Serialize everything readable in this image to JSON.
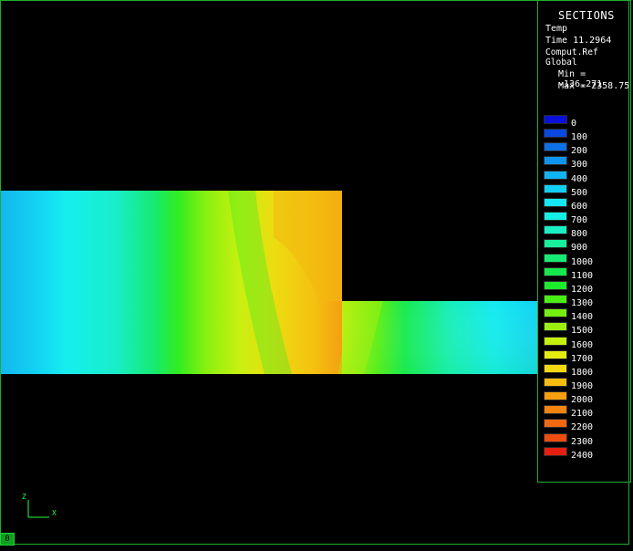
{
  "panel": {
    "title": "SECTIONS",
    "result": "Temp",
    "time": "Time 11.2964",
    "reference": "Comput.Ref Global",
    "min": "Min = -136.271",
    "max": "Max = 2358.75"
  },
  "legend": [
    {
      "label": "0",
      "color": "#0a10d8"
    },
    {
      "label": "100",
      "color": "#0b48e0"
    },
    {
      "label": "200",
      "color": "#0d72e8"
    },
    {
      "label": "300",
      "color": "#0e94ee"
    },
    {
      "label": "400",
      "color": "#10b4f2"
    },
    {
      "label": "500",
      "color": "#12cef4"
    },
    {
      "label": "600",
      "color": "#14e6f4"
    },
    {
      "label": "700",
      "color": "#16f0e4"
    },
    {
      "label": "800",
      "color": "#18f0c4"
    },
    {
      "label": "900",
      "color": "#18ee9c"
    },
    {
      "label": "1000",
      "color": "#16ec74"
    },
    {
      "label": "1100",
      "color": "#14e84c"
    },
    {
      "label": "1200",
      "color": "#1cec2c"
    },
    {
      "label": "1300",
      "color": "#48ee14"
    },
    {
      "label": "1400",
      "color": "#74f010"
    },
    {
      "label": "1500",
      "color": "#9cf010"
    },
    {
      "label": "1600",
      "color": "#c4f010"
    },
    {
      "label": "1700",
      "color": "#e4ec10"
    },
    {
      "label": "1800",
      "color": "#f4d810"
    },
    {
      "label": "1900",
      "color": "#f6bc10"
    },
    {
      "label": "2000",
      "color": "#f6a010"
    },
    {
      "label": "2100",
      "color": "#f48410"
    },
    {
      "label": "2200",
      "color": "#f26810"
    },
    {
      "label": "2300",
      "color": "#ee4c10"
    },
    {
      "label": "2400",
      "color": "#e42010"
    }
  ],
  "axes": {
    "z": "Z",
    "x": "X"
  },
  "frame_tab": "0"
}
